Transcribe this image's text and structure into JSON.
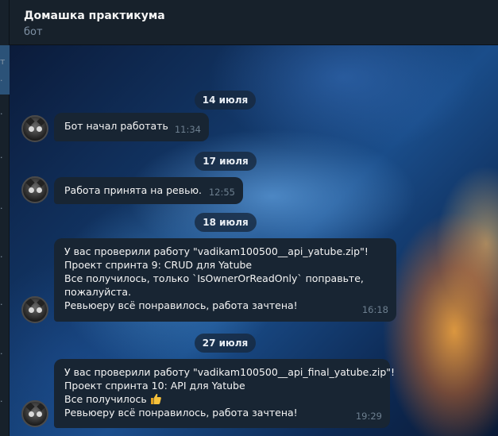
{
  "header": {
    "title": "Домашка практикума",
    "subtitle": "бот"
  },
  "sidebar": {
    "cut_glyph": "т"
  },
  "messages": [
    {
      "date": "14 июля",
      "lines": [
        "Бот начал работать"
      ],
      "time": "11:34"
    },
    {
      "date": "17 июля",
      "lines": [
        "Работа принята на ревью."
      ],
      "time": "12:55"
    },
    {
      "date": "18 июля",
      "lines": [
        "У вас проверили работу \"vadikam100500__api_yatube.zip\"!",
        "Проект спринта 9: CRUD для Yatube",
        "Все получилось, только `IsOwnerOrReadOnly` поправьте,",
        "пожалуйста.",
        "Ревьюеру всё понравилось, работа зачтена!"
      ],
      "time": "16:18"
    },
    {
      "date": "27 июля",
      "lines": [
        "У вас проверили работу \"vadikam100500__api_final_yatube.zip\"!",
        "Проект спринта 10: API для Yatube",
        "Все получилось",
        "Ревьюеру всё понравилось, работа зачтена!"
      ],
      "time": "19:29"
    }
  ],
  "icons": {
    "thumbs_up": "thumbs-up-emoji"
  },
  "colors": {
    "header_bg": "#17212b",
    "bubble_bg": "#182533",
    "date_pill_bg": "#17283c",
    "time_text": "#6d7f8f",
    "subtitle_text": "#7f91a4"
  }
}
